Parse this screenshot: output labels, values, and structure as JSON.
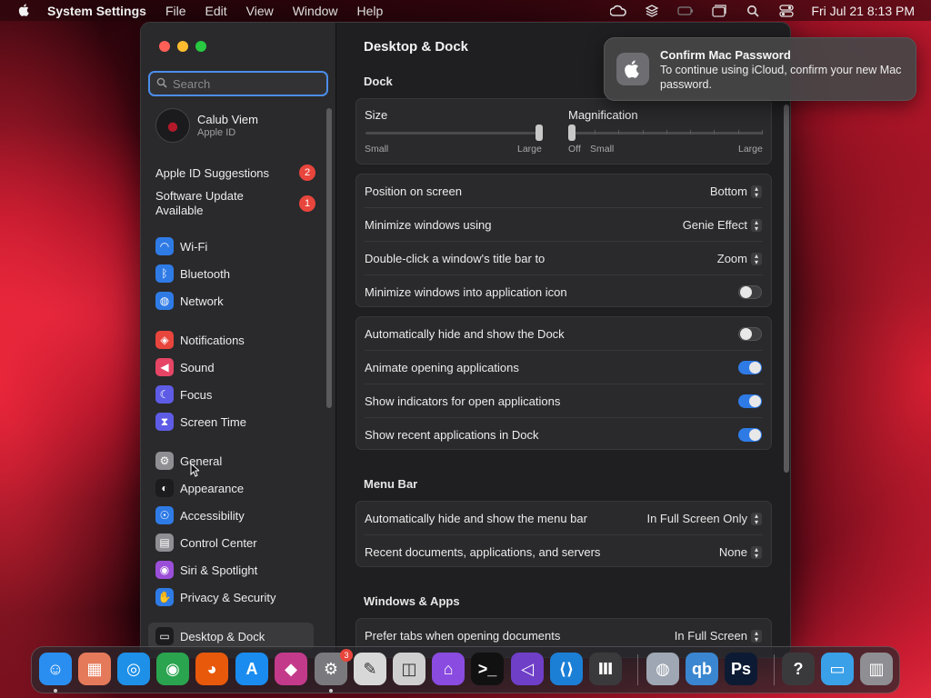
{
  "menubar": {
    "app_name": "System Settings",
    "menus": [
      "File",
      "Edit",
      "View",
      "Window",
      "Help"
    ],
    "status_icons": [
      "creative-cloud-icon",
      "layers-icon",
      "battery-icon",
      "window-icon",
      "search-icon",
      "control-center-icon"
    ],
    "clock": "Fri Jul 21  8:13 PM"
  },
  "sidebar": {
    "search_placeholder": "Search",
    "account": {
      "name": "Calub Viem",
      "subtitle": "Apple ID"
    },
    "suggestions": [
      {
        "label": "Apple ID Suggestions",
        "badge": "2"
      },
      {
        "label": "Software Update Available",
        "badge": "1"
      }
    ],
    "items": [
      {
        "label": "Wi-Fi",
        "icon": "wifi-icon",
        "color": "#2f7be6"
      },
      {
        "label": "Bluetooth",
        "icon": "bluetooth-icon",
        "color": "#2f7be6"
      },
      {
        "label": "Network",
        "icon": "globe-icon",
        "color": "#2f7be6"
      },
      {
        "label": "Notifications",
        "icon": "bell-icon",
        "color": "#e8453c"
      },
      {
        "label": "Sound",
        "icon": "speaker-icon",
        "color": "#e64566"
      },
      {
        "label": "Focus",
        "icon": "moon-icon",
        "color": "#5e5ce6"
      },
      {
        "label": "Screen Time",
        "icon": "hourglass-icon",
        "color": "#5e5ce6"
      },
      {
        "label": "General",
        "icon": "gear-icon",
        "color": "#8e8e93"
      },
      {
        "label": "Appearance",
        "icon": "appearance-icon",
        "color": "#1c1c1e"
      },
      {
        "label": "Accessibility",
        "icon": "accessibility-icon",
        "color": "#2f7be6"
      },
      {
        "label": "Control Center",
        "icon": "control-center-icon",
        "color": "#8e8e93"
      },
      {
        "label": "Siri & Spotlight",
        "icon": "siri-icon",
        "color": "#9b4fd9"
      },
      {
        "label": "Privacy & Security",
        "icon": "hand-icon",
        "color": "#2f7be6"
      },
      {
        "label": "Desktop & Dock",
        "icon": "dock-icon",
        "color": "#1c1c1e"
      }
    ]
  },
  "main": {
    "title": "Desktop & Dock",
    "dock_section": "Dock",
    "size": {
      "label": "Size",
      "min": "Small",
      "max": "Large",
      "value": 1.0
    },
    "magnification": {
      "label": "Magnification",
      "off": "Off",
      "min": "Small",
      "max": "Large",
      "value": 0.0
    },
    "group1": [
      {
        "label": "Position on screen",
        "value": "Bottom"
      },
      {
        "label": "Minimize windows using",
        "value": "Genie Effect"
      },
      {
        "label": "Double-click a window's title bar to",
        "value": "Zoom"
      },
      {
        "label": "Minimize windows into application icon",
        "toggle": "off"
      }
    ],
    "group2": [
      {
        "label": "Automatically hide and show the Dock",
        "toggle": "off"
      },
      {
        "label": "Animate opening applications",
        "toggle": "on"
      },
      {
        "label": "Show indicators for open applications",
        "toggle": "on"
      },
      {
        "label": "Show recent applications in Dock",
        "toggle": "on"
      }
    ],
    "menubar_section": "Menu Bar",
    "group3": [
      {
        "label": "Automatically hide and show the menu bar",
        "value": "In Full Screen Only"
      },
      {
        "label": "Recent documents, applications, and servers",
        "value": "None"
      }
    ],
    "windows_section": "Windows & Apps",
    "group4": [
      {
        "label": "Prefer tabs when opening documents",
        "value": "In Full Screen"
      }
    ]
  },
  "notification": {
    "title": "Confirm Mac Password",
    "body": "To continue using iCloud, confirm your new Mac password."
  },
  "dock": {
    "apps": [
      {
        "name": "finder-icon",
        "glyph": "☺",
        "color": "#2a8ef0",
        "running": true
      },
      {
        "name": "launchpad-icon",
        "glyph": "▦",
        "color": "#e57a5a",
        "running": false
      },
      {
        "name": "safari-icon",
        "glyph": "◎",
        "color": "#1e90e8",
        "running": false
      },
      {
        "name": "chrome-icon",
        "glyph": "◉",
        "color": "#2aa44f",
        "running": false
      },
      {
        "name": "firefox-icon",
        "glyph": "◕",
        "color": "#e8590c",
        "running": false
      },
      {
        "name": "app-store-icon",
        "glyph": "A",
        "color": "#1a8cf0",
        "running": false
      },
      {
        "name": "shortcuts-icon",
        "glyph": "◆",
        "color": "#c43a8a",
        "running": false
      },
      {
        "name": "system-settings-icon",
        "glyph": "⚙",
        "color": "#7a7a7e",
        "running": true,
        "badge": "3"
      },
      {
        "name": "textedit-icon",
        "glyph": "✎",
        "color": "#d8d8d8",
        "running": false
      },
      {
        "name": "screenshot-icon",
        "glyph": "◫",
        "color": "#cfcfcf",
        "running": false
      },
      {
        "name": "podcasts-icon",
        "glyph": "⌂",
        "color": "#8a4be0",
        "running": false
      },
      {
        "name": "terminal-icon",
        "glyph": ">_",
        "color": "#111111",
        "running": false
      },
      {
        "name": "visual-studio-icon",
        "glyph": "◁",
        "color": "#6f3fc8",
        "running": false
      },
      {
        "name": "vscode-icon",
        "glyph": "⟨⟩",
        "color": "#1c7fd6",
        "running": false
      },
      {
        "name": "museum-icon",
        "glyph": "Ⅲ",
        "color": "#3a3a3c",
        "running": false
      },
      {
        "name": "disk-utility-icon",
        "glyph": "◍",
        "color": "#9ea7b3",
        "running": false
      },
      {
        "name": "qbittorrent-icon",
        "glyph": "qb",
        "color": "#3a86d0",
        "running": false
      },
      {
        "name": "photoshop-icon",
        "glyph": "Ps",
        "color": "#0d1a33",
        "running": false
      },
      {
        "name": "help-icon",
        "glyph": "?",
        "color": "#3a3a3c",
        "running": false
      },
      {
        "name": "folder-icon",
        "glyph": "▭",
        "color": "#3aa0e8",
        "running": false
      },
      {
        "name": "trash-icon",
        "glyph": "▥",
        "color": "#8e8e93",
        "running": false
      }
    ]
  }
}
